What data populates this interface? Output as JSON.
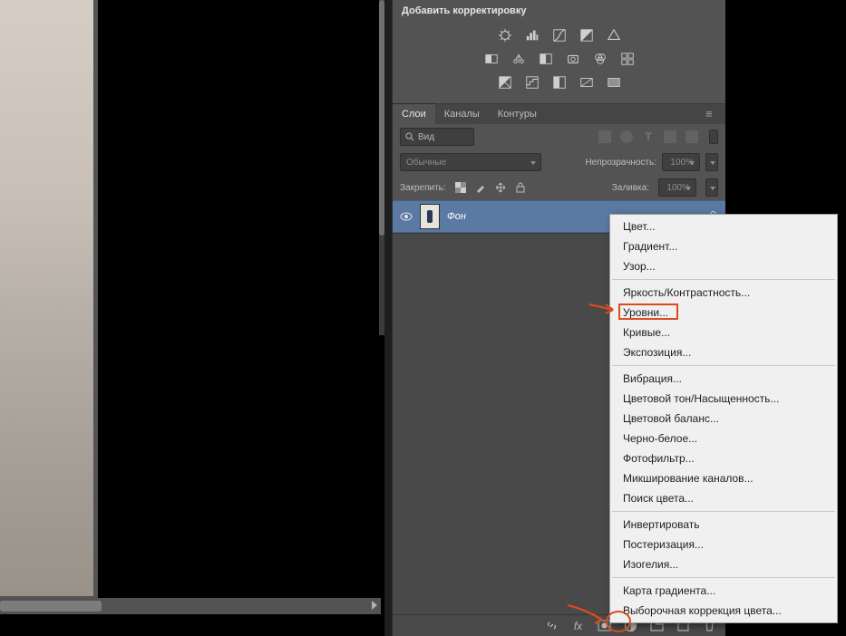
{
  "adjustments": {
    "title": "Добавить корректировку"
  },
  "layers_panel": {
    "tabs": {
      "layers": "Слои",
      "channels": "Каналы",
      "paths": "Контуры"
    },
    "filter_label": "Вид",
    "blend_mode": "Обычные",
    "opacity_label": "Непрозрачность:",
    "opacity_value": "100%",
    "lock_label": "Закрепить:",
    "fill_label": "Заливка:",
    "fill_value": "100%",
    "layer": {
      "name": "Фон"
    }
  },
  "context_menu": {
    "group1": [
      "Цвет...",
      "Градиент...",
      "Узор..."
    ],
    "group2": [
      "Яркость/Контрастность...",
      "Уровни...",
      "Кривые...",
      "Экспозиция..."
    ],
    "group3": [
      "Вибрация...",
      "Цветовой тон/Насыщенность...",
      "Цветовой баланс...",
      "Черно-белое...",
      "Фотофильтр...",
      "Микширование каналов...",
      "Поиск цвета..."
    ],
    "group4": [
      "Инвертировать",
      "Постеризация...",
      "Изогелия..."
    ],
    "group5": [
      "Карта градиента...",
      "Выборочная коррекция цвета..."
    ]
  }
}
